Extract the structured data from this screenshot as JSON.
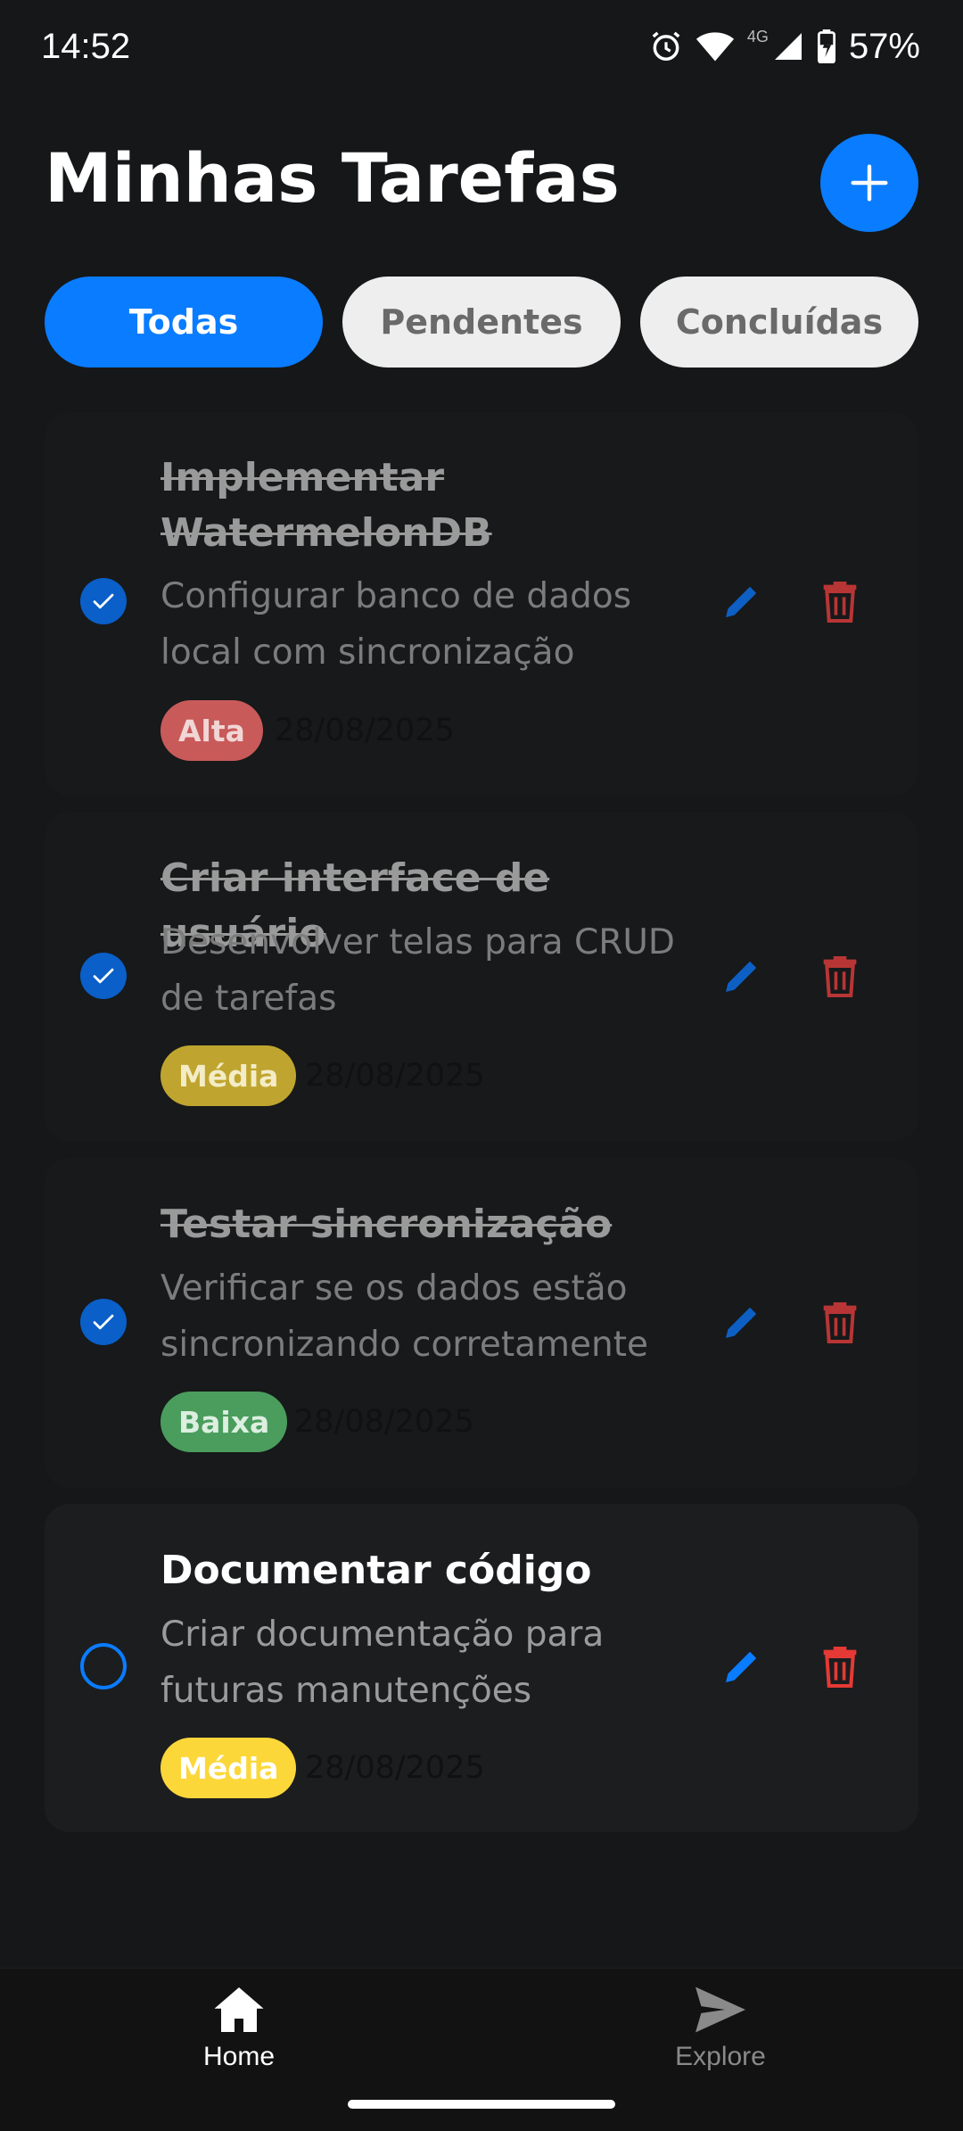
{
  "status_bar": {
    "time": "14:52",
    "network": "4G",
    "battery": "57%",
    "icons": [
      "alarm-icon",
      "wifi-icon",
      "signal-icon",
      "battery-charging-icon"
    ]
  },
  "header": {
    "title": "Minhas Tarefas",
    "add_icon": "plus-icon"
  },
  "filters": {
    "tabs": [
      {
        "label": "Todas",
        "active": true
      },
      {
        "label": "Pendentes",
        "active": false
      },
      {
        "label": "Concluídas",
        "active": false
      }
    ]
  },
  "tasks": [
    {
      "title": "Implementar WatermelonDB",
      "description": "Configurar banco de dados local com sincronização",
      "priority": "Alta",
      "date": "28/08/2025",
      "completed": true
    },
    {
      "title": "Criar interface de usuário",
      "description": "Desenvolver telas para CRUD de tarefas",
      "priority": "Média",
      "date": "28/08/2025",
      "completed": true
    },
    {
      "title": "Testar sincronização",
      "description": "Verificar se os dados estão sincronizando corretamente",
      "priority": "Baixa",
      "date": "28/08/2025",
      "completed": true
    },
    {
      "title": "Documentar código",
      "description": "Criar documentação para futuras manutenções",
      "priority": "Média",
      "date": "28/08/2025",
      "completed": false
    }
  ],
  "colors": {
    "accent": "#0a7cff",
    "priority_alta": "#c95a5a",
    "priority_media_done": "#bfa52f",
    "priority_media": "#fcd73a",
    "priority_baixa": "#4a9d5d",
    "delete": "#e53935"
  },
  "bottom_nav": {
    "items": [
      {
        "label": "Home",
        "icon": "home-icon",
        "active": true
      },
      {
        "label": "Explore",
        "icon": "paper-plane-icon",
        "active": false
      }
    ]
  }
}
